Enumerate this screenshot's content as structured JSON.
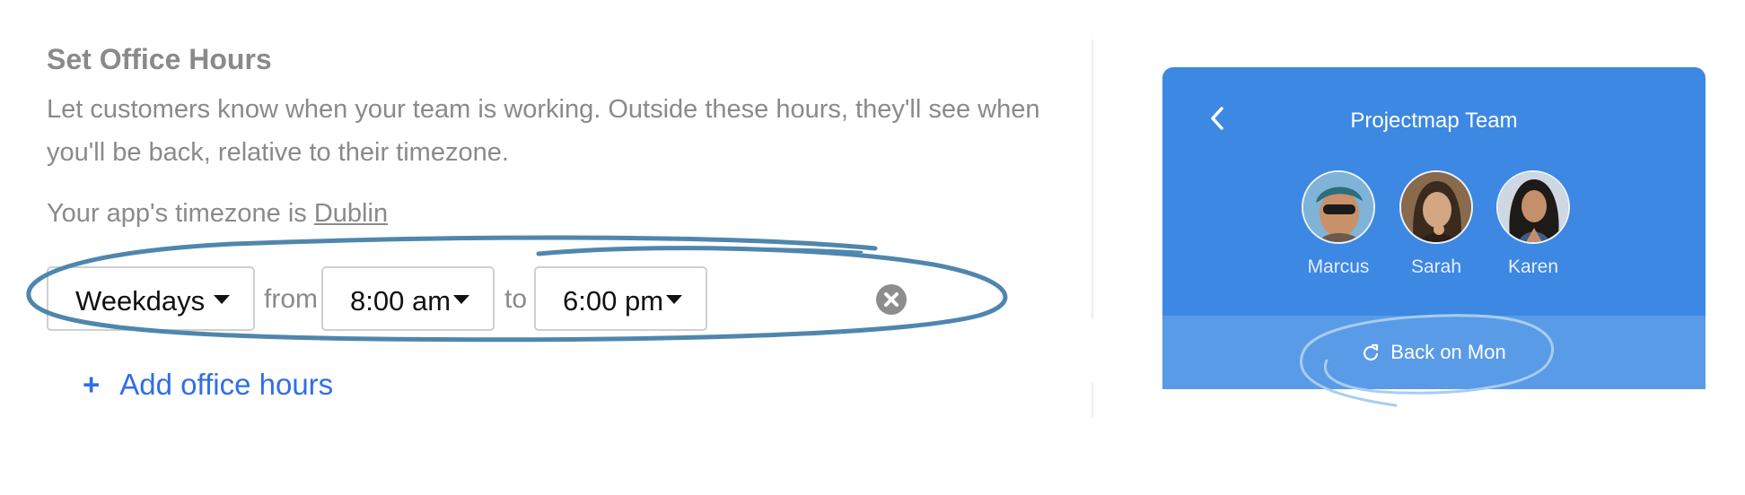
{
  "settings": {
    "title": "Set Office Hours",
    "description": "Let customers know when your team is working. Outside these hours, they'll see when you'll be back, relative to their timezone.",
    "timezone_prefix": "Your app's timezone is ",
    "timezone_link": "Dublin",
    "hours_row": {
      "days_value": "Weekdays",
      "from_label": "from",
      "start_value": "8:00 am",
      "to_label": "to",
      "end_value": "6:00 pm",
      "remove_icon": "remove-circle-icon"
    },
    "add_hours": {
      "plus": "+",
      "label": "Add office hours"
    }
  },
  "preview": {
    "team_name": "Projectmap Team",
    "back_icon": "chevron-left-icon",
    "members": [
      {
        "name": "Marcus"
      },
      {
        "name": "Sarah"
      },
      {
        "name": "Karen"
      }
    ],
    "status_icon": "refresh-icon",
    "status_text": "Back on Mon"
  },
  "colors": {
    "accent_link": "#2f6fe4",
    "widget_blue": "#3d88e2",
    "widget_strip": "#5a9be7",
    "annotation_stroke": "#4f86ad",
    "muted_text": "#8a8a8a"
  }
}
